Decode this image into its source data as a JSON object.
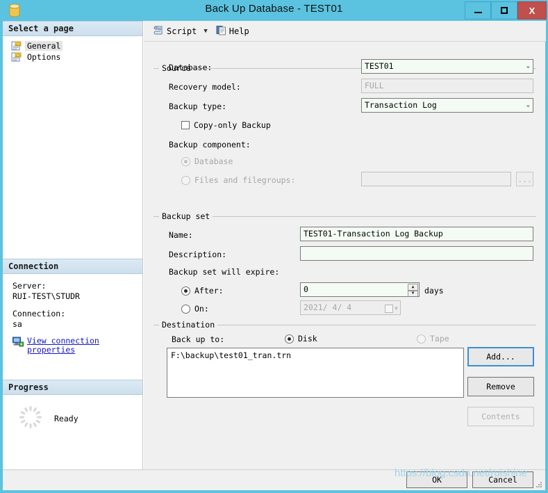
{
  "window": {
    "title": "Back Up Database - TEST01",
    "icon": "database-cylinder-icon",
    "minimize_label": "–",
    "maximize_label": "□",
    "close_label": "X",
    "accent_color": "#5bc2e0",
    "close_color": "#c0504d"
  },
  "sidebar": {
    "select_page_header": "Select a page",
    "pages": [
      {
        "label": "General",
        "selected": true
      },
      {
        "label": "Options",
        "selected": false
      }
    ],
    "connection": {
      "header": "Connection",
      "server_label": "Server:",
      "server_value": "RUI-TEST\\STUDR",
      "connection_label": "Connection:",
      "connection_value": "sa",
      "link_line1": "View connection",
      "link_line2": "properties",
      "link_color": "#1414c8"
    },
    "progress": {
      "header": "Progress",
      "status": "Ready"
    }
  },
  "toolbar": {
    "script_label": "Script",
    "script_caret": "▼",
    "help_label": "Help"
  },
  "source": {
    "group_title": "Source",
    "database_label": "Database:",
    "database_value": "TEST01",
    "recovery_label": "Recovery model:",
    "recovery_value": "FULL",
    "backup_type_label": "Backup type:",
    "backup_type_value": "Transaction Log",
    "copy_only_label": "Copy-only Backup",
    "copy_only_checked": false,
    "component_label": "Backup component:",
    "component_database_label": "Database",
    "component_files_label": "Files and filegroups:",
    "component_files_value": "",
    "browse_label": "...",
    "caret": "⌄"
  },
  "backup_set": {
    "group_title": "Backup set",
    "name_label": "Name:",
    "name_value": "TEST01-Transaction Log  Backup",
    "description_label": "Description:",
    "description_value": "",
    "expire_label": "Backup set will expire:",
    "after_label": "After:",
    "after_value": "0",
    "days_label": "days",
    "on_label": "On:",
    "on_value": "2021/ 4/ 4",
    "spin_up": "▲",
    "spin_down": "▼"
  },
  "destination": {
    "group_title": "Destination",
    "backup_to_label": "Back up to:",
    "disk_label": "Disk",
    "tape_label": "Tape",
    "selected": "Disk",
    "paths": [
      "F:\\backup\\test01_tran.trn"
    ],
    "add_label": "Add...",
    "remove_label": "Remove",
    "contents_label": "Contents"
  },
  "footer": {
    "ok_label": "OK",
    "cancel_label": "Cancel"
  },
  "watermark": {
    "text": "https://blog.csdn.net/ruishine"
  }
}
